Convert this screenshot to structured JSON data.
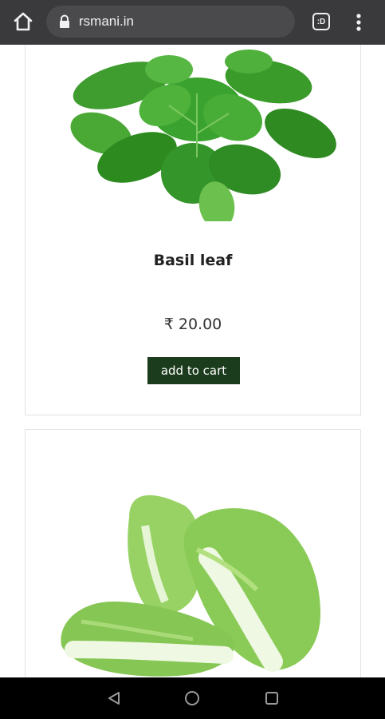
{
  "browser": {
    "url": "rsmani.in",
    "tab_count": ":D"
  },
  "products": [
    {
      "name": "Basil leaf",
      "price": "₹ 20.00",
      "add_to_cart_label": "add to cart",
      "image_icon": "basil-leaf-image"
    },
    {
      "image_icon": "napa-cabbage-image"
    }
  ],
  "colors": {
    "topbar": "#3a3a3c",
    "add_to_cart_button": "#1c3d1d",
    "navbar": "#000000"
  }
}
